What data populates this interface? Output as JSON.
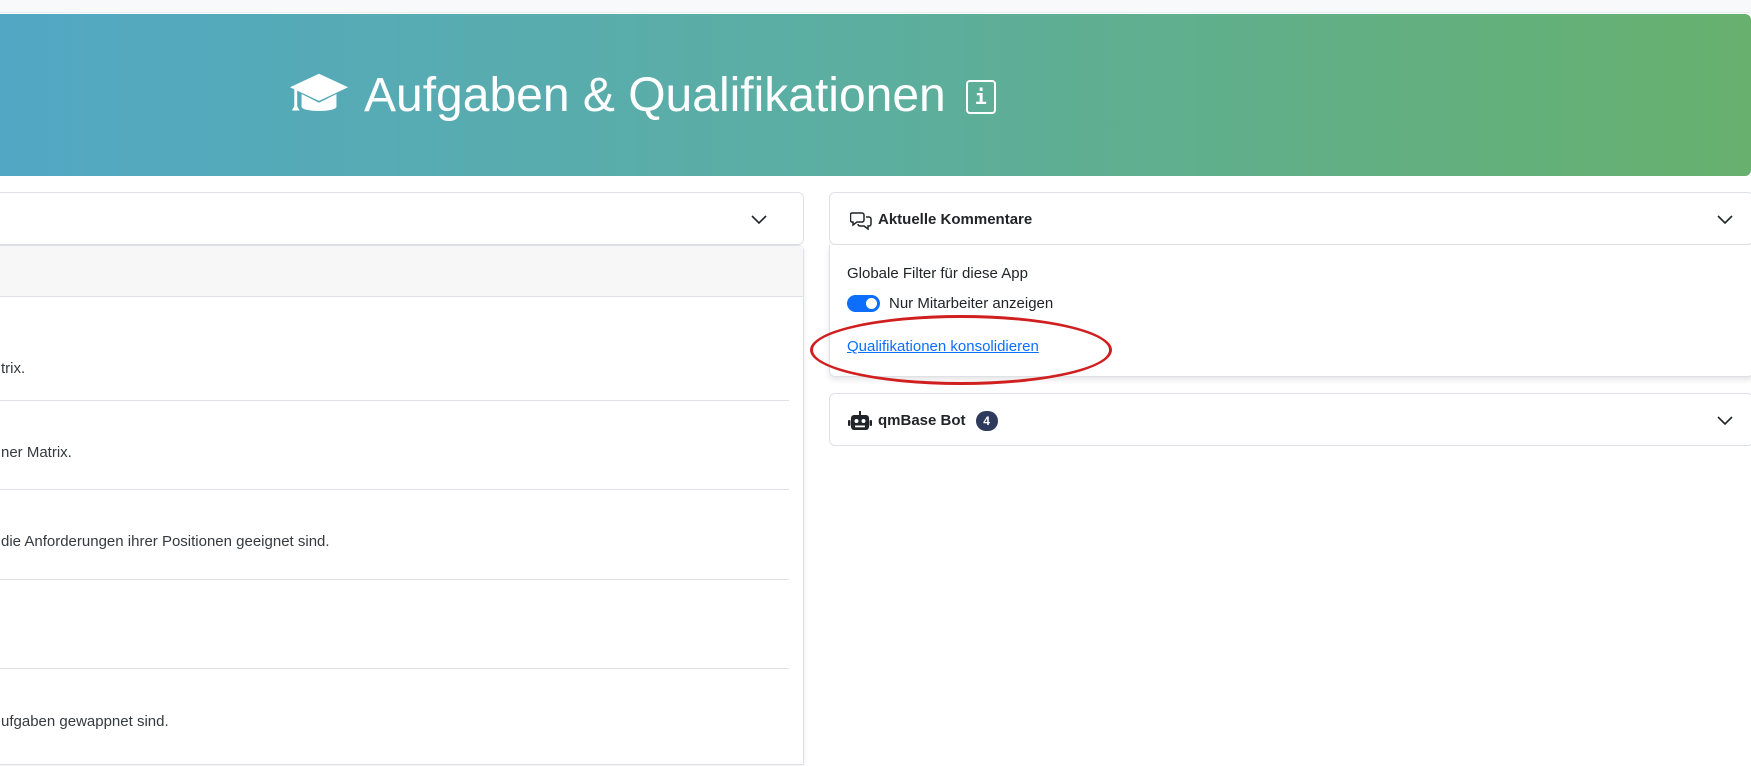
{
  "banner": {
    "title": "Aufgaben & Qualifikationen",
    "info_label": "i",
    "icon": "graduation-cap-icon"
  },
  "left_rows": [
    "trix.",
    "ner Matrix.",
    "die Anforderungen ihrer Positionen geeignet sind.",
    "",
    "ufgaben gewappnet sind."
  ],
  "comments": {
    "title": "Aktuelle Kommentare",
    "icon": "comments-icon"
  },
  "filters": {
    "title": "Globale Filter für diese App",
    "toggle_label": "Nur Mitarbeiter anzeigen",
    "toggle_on": true,
    "link": "Qualifikationen konsolidieren"
  },
  "bot": {
    "title": "qmBase Bot",
    "badge": "4",
    "icon": "robot-icon"
  },
  "colors": {
    "gradient_start": "#52a8c4",
    "gradient_end": "#67b06e",
    "primary": "#0d6efd",
    "annotation": "#d01f1f",
    "badge": "#2f3b5c"
  }
}
